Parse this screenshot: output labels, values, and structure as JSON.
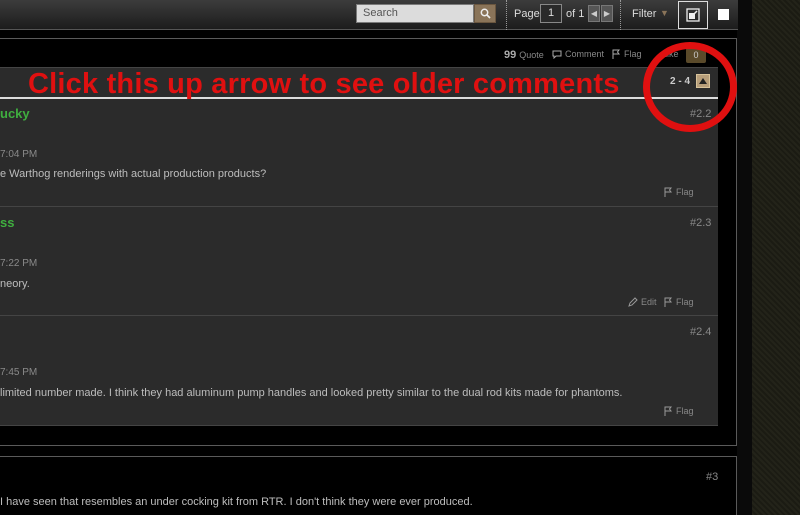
{
  "topbar": {
    "search_placeholder": "Search",
    "page_label": "Page",
    "page_value": "1",
    "page_of": "of 1",
    "filter_label": "Filter",
    "icons": [
      "search-icon",
      "chevron-left-icon",
      "chevron-right-icon",
      "chevron-down-icon",
      "popout-icon"
    ]
  },
  "actions": {
    "quote": "Quote",
    "comment": "Comment",
    "flag": "Flag",
    "like": "Like",
    "like_count": "0"
  },
  "comment_header": {
    "range": "2 - 4",
    "annotation": "Click this up arrow to see older comments"
  },
  "comments": [
    {
      "author": "ucky",
      "number": "#2.2",
      "time": "7:04 PM",
      "text": "e Warthog renderings with actual production products?",
      "actions": [
        "Flag"
      ]
    },
    {
      "author": "ss",
      "number": "#2.3",
      "time": "7:22 PM",
      "text": "neory.",
      "actions": [
        "Edit",
        "Flag"
      ]
    },
    {
      "author": "",
      "number": "#2.4",
      "time": "7:45 PM",
      "text": " limited number made. I think they had aluminum pump handles and looked pretty similar to the dual rod kits made for phantoms.",
      "actions": [
        "Flag"
      ]
    }
  ],
  "post3": {
    "number": "#3",
    "text": "I have seen that resembles an under cocking kit from RTR. I don't think they were ever produced."
  },
  "colors": {
    "accent": "#8a7459",
    "author": "#3fae3f",
    "annotation": "#e01010"
  }
}
